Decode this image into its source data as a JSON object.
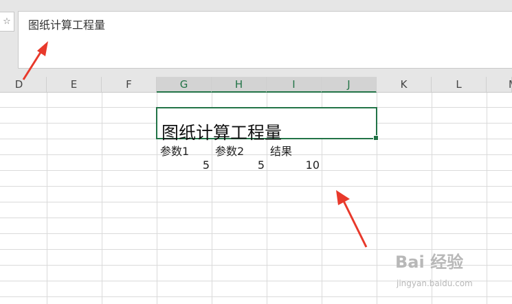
{
  "formula_bar": {
    "fx_icon": "fx-icon",
    "content": "图纸计算工程量"
  },
  "columns": [
    "D",
    "E",
    "F",
    "G",
    "H",
    "I",
    "J",
    "K",
    "L",
    "M"
  ],
  "selected_columns": [
    "G",
    "H",
    "I",
    "J"
  ],
  "sheet": {
    "title_cell": "图纸计算工程量",
    "headers": [
      "参数1",
      "参数2",
      "结果"
    ],
    "values": [
      "5",
      "5",
      "10"
    ]
  },
  "annotations": {
    "arrow_color": "#e8392b"
  },
  "watermark": {
    "logo": "Bai 经验",
    "url": "jingyan.baidu.com"
  },
  "colors": {
    "accent": "#217346",
    "header_bg": "#e6e6e6"
  }
}
